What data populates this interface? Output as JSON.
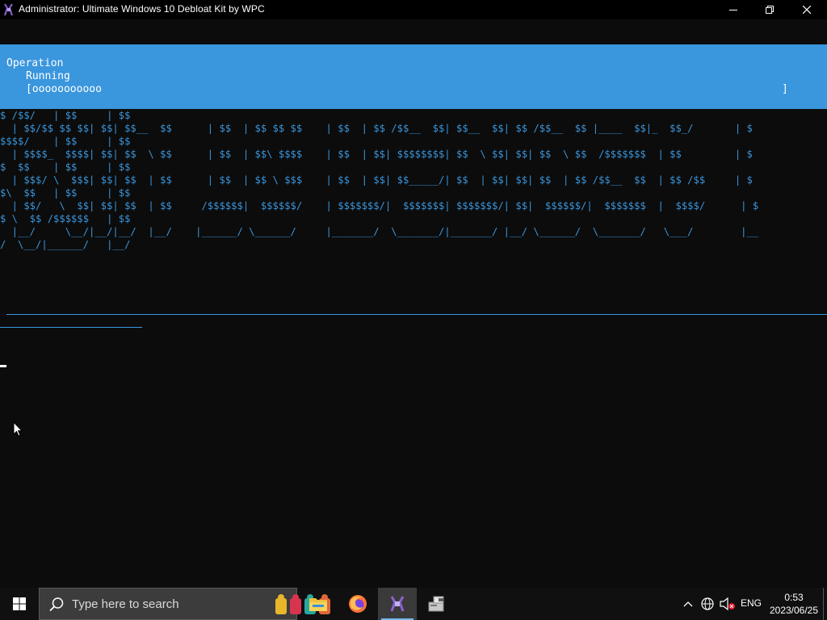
{
  "window": {
    "title": "Administrator:  Ultimate Windows 10 Debloat Kit by WPC"
  },
  "progress": {
    "operation": "Operation",
    "status": "Running",
    "bar": "[ooooooooooo",
    "bar_end": "]"
  },
  "console": {
    "banner": "$ /$$/   | $$     | $$\n  | $$/$$ $$ $$| $$| $$__  $$      | $$  | $$ $$ $$    | $$  | $$ /$$__  $$| $$__  $$| $$ /$$__  $$ |____  $$|_  $$_/       | $\n$$$$/    | $$     | $$\n  | $$$$_  $$$$| $$| $$  \\ $$      | $$  | $$\\ $$$$    | $$  | $$| $$$$$$$$| $$  \\ $$| $$| $$  \\ $$  /$$$$$$$  | $$         | $\n$  $$    | $$     | $$\n  | $$$/ \\  $$$| $$| $$  | $$      | $$  | $$ \\ $$$    | $$  | $$| $$_____/| $$  | $$| $$| $$  | $$ /$$__  $$  | $$ /$$     | $\n$\\  $$   | $$     | $$\n  | $$/   \\  $$| $$| $$  | $$     /$$$$$$|  $$$$$$/    | $$$$$$$/|  $$$$$$$| $$$$$$$/| $$|  $$$$$$/|  $$$$$$$  |  $$$$/      | $\n$ \\  $$ /$$$$$$   | $$\n  |__/     \\__/|__/|__/  |__/    |______/ \\______/     |_______/  \\_______/|_______/ |__/ \\______/  \\_______/   \\___/        |__\n/  \\__/|______/   |__/"
  },
  "taskbar": {
    "search_placeholder": "Type here to search",
    "apps": [
      "File Explorer",
      "Firefox",
      "Ultimate Windows 10 Debloat Kit",
      "Installer"
    ],
    "active_app": "Ultimate Windows 10 Debloat Kit",
    "language": "ENG",
    "time": "0:53",
    "date": "2023/06/25"
  },
  "colors": {
    "console_bg": "#0c0c0c",
    "accent_blue": "#3a96dd",
    "taskbar_bg": "#101010",
    "search_bg": "#3c3c3c"
  },
  "icons": {
    "app": "debloat-kit-icon",
    "start": "windows-logo-icon",
    "search": "search-icon",
    "tray_chevron": "chevron-up-icon",
    "network": "globe-network-icon",
    "volume": "volume-muted-icon"
  }
}
